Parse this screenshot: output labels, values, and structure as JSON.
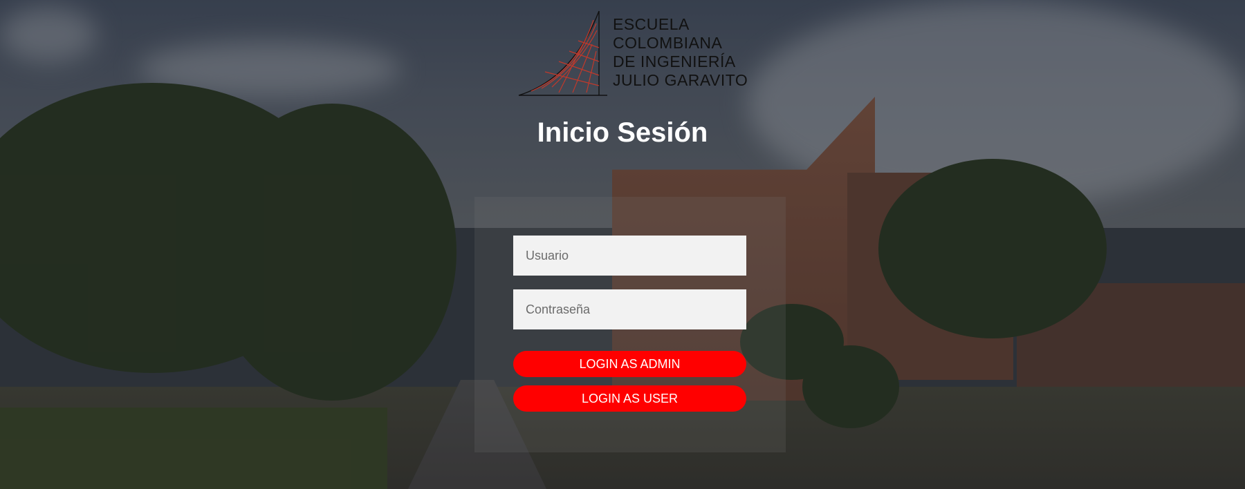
{
  "logo": {
    "lines": [
      "ESCUELA",
      "COLOMBIANA",
      "DE INGENIERÍA",
      "JULIO GARAVITO"
    ]
  },
  "title": "Inicio Sesión",
  "form": {
    "username_placeholder": "Usuario",
    "username_value": "",
    "password_placeholder": "Contraseña",
    "password_value": "",
    "login_admin_label": "LOGIN AS ADMIN",
    "login_user_label": "LOGIN AS USER"
  },
  "colors": {
    "accent": "#ff0000",
    "input_bg": "#f2f2f2",
    "title_text": "#ffffff"
  }
}
